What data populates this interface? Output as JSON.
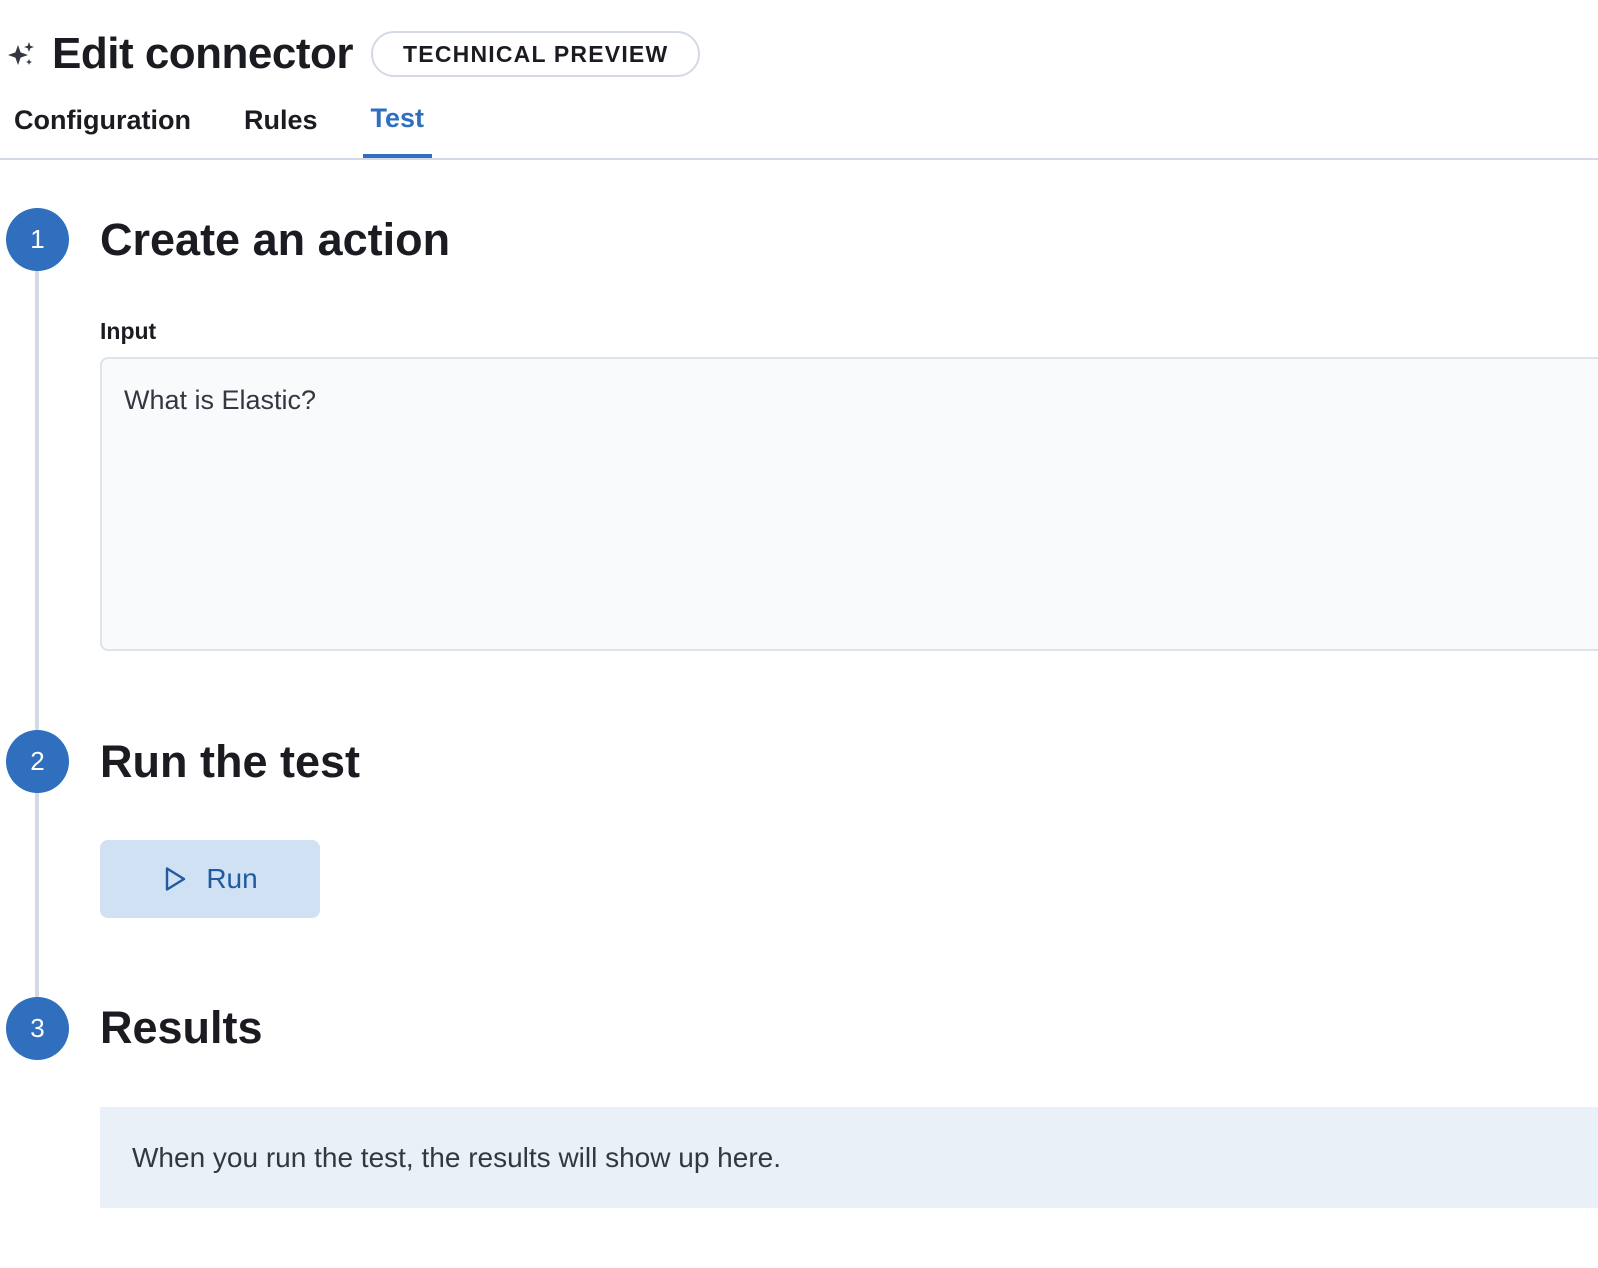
{
  "header": {
    "icon": "sparkles-icon",
    "title": "Edit connector",
    "badge": "TECHNICAL PREVIEW"
  },
  "tabs": [
    {
      "label": "Configuration",
      "active": false
    },
    {
      "label": "Rules",
      "active": false
    },
    {
      "label": "Test",
      "active": true
    }
  ],
  "steps": [
    {
      "number": "1",
      "title": "Create an action"
    },
    {
      "number": "2",
      "title": "Run the test"
    },
    {
      "number": "3",
      "title": "Results"
    }
  ],
  "input": {
    "label": "Input",
    "value": "What is Elastic?"
  },
  "run": {
    "icon": "play-icon",
    "label": "Run"
  },
  "results": {
    "empty_message": "When you run the test, the results will show up here."
  },
  "colors": {
    "accent": "#2f6fbe",
    "button_bg": "#cfe1f2",
    "results_bg": "#e9f0f8",
    "border": "#d3dae6"
  }
}
